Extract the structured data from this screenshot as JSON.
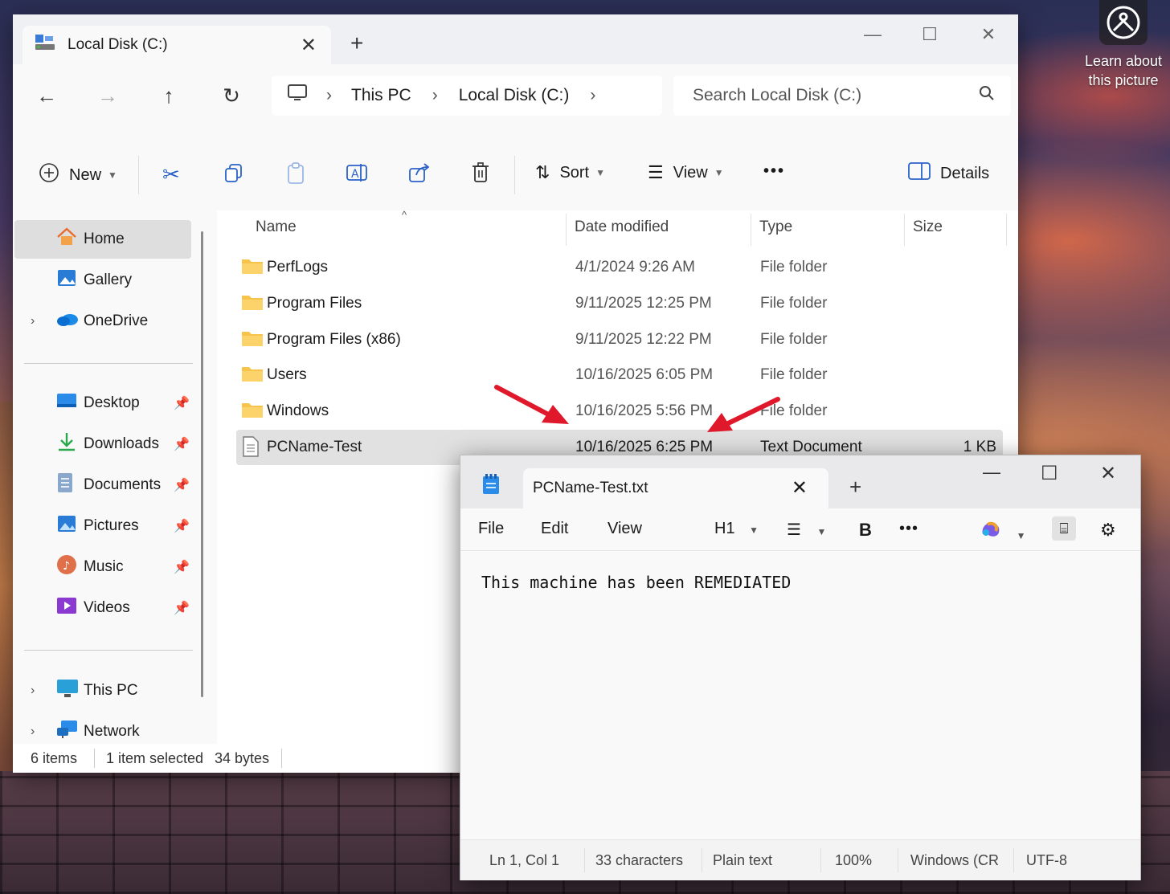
{
  "learn": {
    "label_line1": "Learn about",
    "label_line2": "this picture"
  },
  "explorer": {
    "tab_title": "Local Disk (C:)",
    "window_controls": {
      "minimize": "—",
      "maximize": "☐",
      "close": "✕"
    },
    "breadcrumb": [
      "This PC",
      "Local Disk (C:)"
    ],
    "search_placeholder": "Search Local Disk (C:)",
    "toolbar": {
      "new": "New",
      "sort": "Sort",
      "view": "View",
      "more": "•••",
      "details": "Details"
    },
    "sidebar": {
      "top": [
        {
          "label": "Home",
          "icon": "home-icon"
        },
        {
          "label": "Gallery",
          "icon": "gallery-icon"
        },
        {
          "label": "OneDrive",
          "icon": "onedrive-icon"
        }
      ],
      "quick": [
        {
          "label": "Desktop",
          "icon": "desktop-icon"
        },
        {
          "label": "Downloads",
          "icon": "downloads-icon"
        },
        {
          "label": "Documents",
          "icon": "documents-icon"
        },
        {
          "label": "Pictures",
          "icon": "pictures-icon"
        },
        {
          "label": "Music",
          "icon": "music-icon"
        },
        {
          "label": "Videos",
          "icon": "videos-icon"
        }
      ],
      "bottom": [
        {
          "label": "This PC",
          "icon": "this-pc-icon"
        },
        {
          "label": "Network",
          "icon": "network-icon"
        }
      ]
    },
    "columns": {
      "name": "Name",
      "date": "Date modified",
      "type": "Type",
      "size": "Size"
    },
    "files": [
      {
        "name": "PerfLogs",
        "date": "4/1/2024 9:26 AM",
        "type": "File folder",
        "size": ""
      },
      {
        "name": "Program Files",
        "date": "9/11/2025 12:25 PM",
        "type": "File folder",
        "size": ""
      },
      {
        "name": "Program Files (x86)",
        "date": "9/11/2025 12:22 PM",
        "type": "File folder",
        "size": ""
      },
      {
        "name": "Users",
        "date": "10/16/2025 6:05 PM",
        "type": "File folder",
        "size": ""
      },
      {
        "name": "Windows",
        "date": "10/16/2025 5:56 PM",
        "type": "File folder",
        "size": ""
      },
      {
        "name": "PCName-Test",
        "date": "10/16/2025 6:25 PM",
        "type": "Text Document",
        "size": "1 KB"
      }
    ],
    "status": {
      "items": "6 items",
      "selected": "1 item selected",
      "bytes": "34 bytes"
    }
  },
  "notepad": {
    "tab_title": "PCName-Test.txt",
    "window_controls": {
      "minimize": "—",
      "maximize": "☐",
      "close": "✕"
    },
    "menu": {
      "file": "File",
      "edit": "Edit",
      "view": "View",
      "heading": "H1",
      "bold": "B",
      "more": "•••"
    },
    "content": "This machine has been REMEDIATED",
    "status": {
      "position": "Ln 1, Col 1",
      "chars": "33 characters",
      "format": "Plain text",
      "zoom": "100%",
      "eol": "Windows (CR",
      "encoding": "UTF-8"
    }
  },
  "colors": {
    "arrow": "#e0182c",
    "folder": "#f8c34a",
    "selection": "#e1e1e1"
  }
}
